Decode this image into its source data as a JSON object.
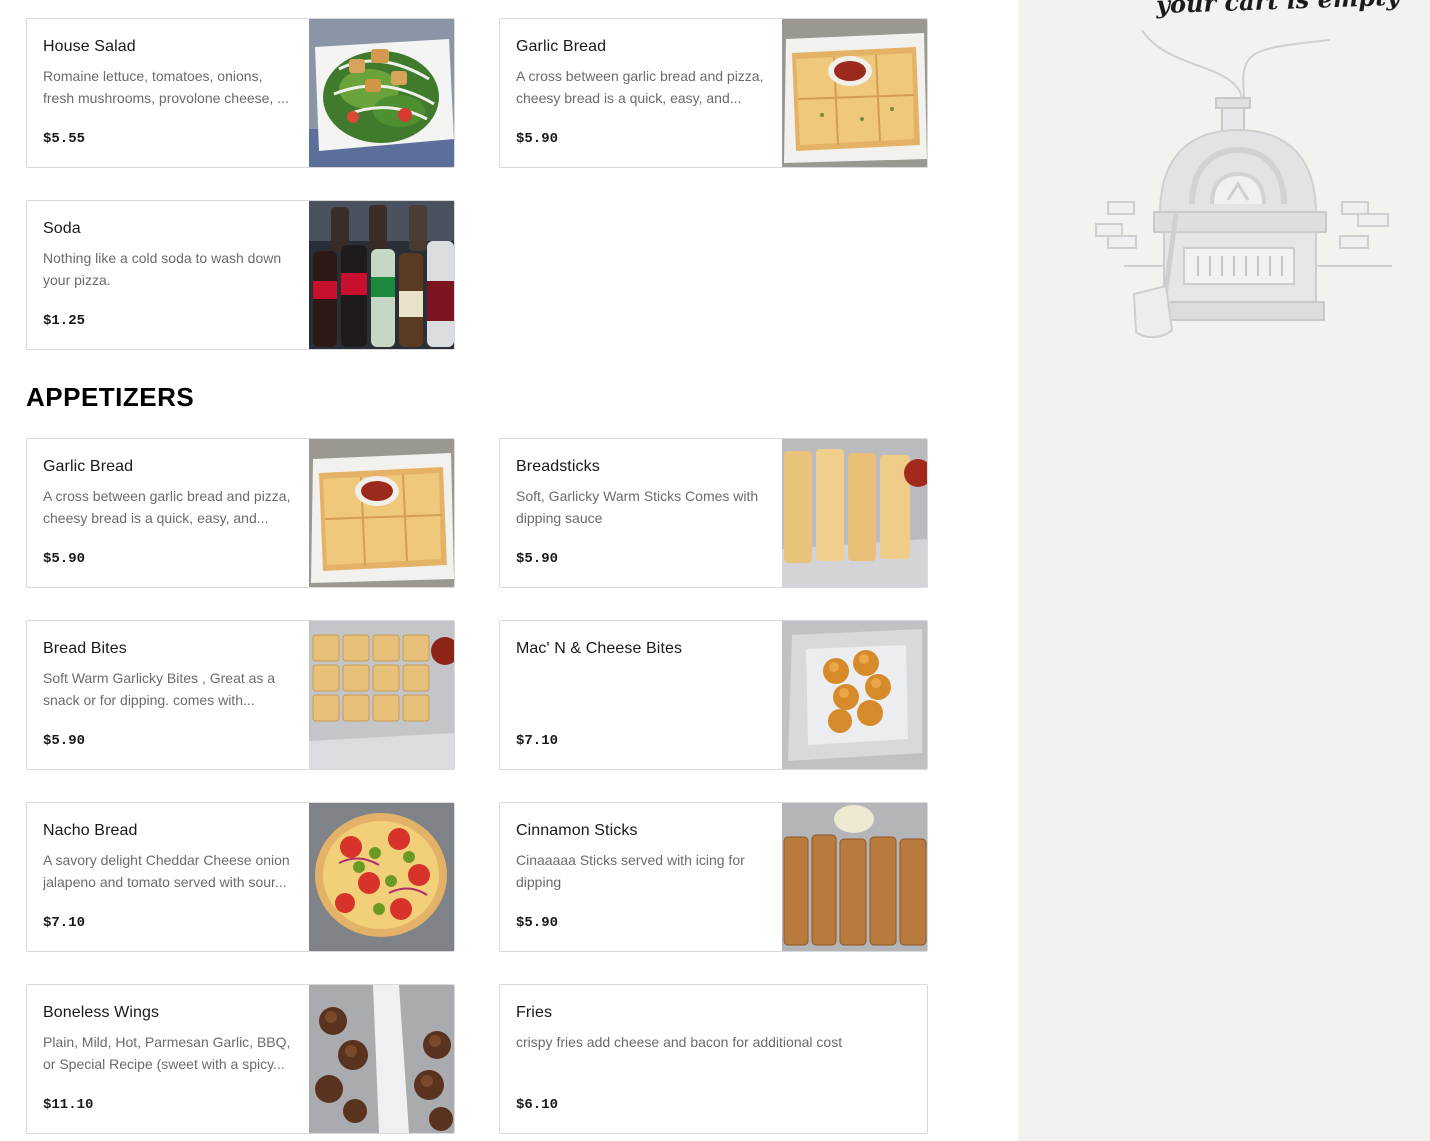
{
  "menu": {
    "top_items": [
      {
        "name": "House Salad",
        "description": "Romaine lettuce, tomatoes, onions, fresh mushrooms, provolone cheese, ...",
        "price": "$5.55",
        "image": "house-salad-photo"
      },
      {
        "name": "Garlic Bread",
        "description": "A cross between garlic bread and pizza, cheesy bread is a quick, easy, and...",
        "price": "$5.90",
        "image": "garlic-bread-photo"
      },
      {
        "name": "Soda",
        "description": "Nothing like a cold soda to wash down your pizza.",
        "price": "$1.25",
        "image": "soda-bottles-photo"
      }
    ],
    "appetizers": {
      "title": "APPETIZERS",
      "items": [
        {
          "name": "Garlic Bread",
          "description": "A cross between garlic bread and pizza, cheesy bread is a quick, easy, and...",
          "price": "$5.90",
          "image": "garlic-bread-photo"
        },
        {
          "name": "Breadsticks",
          "description": "Soft, Garlicky Warm Sticks Comes with dipping sauce",
          "price": "$5.90",
          "image": "breadsticks-photo"
        },
        {
          "name": "Bread Bites",
          "description": "Soft Warm Garlicky Bites , Great as a snack or for dipping. comes with...",
          "price": "$5.90",
          "image": "bread-bites-photo"
        },
        {
          "name": "Mac' N & Cheese Bites",
          "description": "",
          "price": "$7.10",
          "image": "mac-cheese-bites-photo"
        },
        {
          "name": "Nacho Bread",
          "description": "A savory delight Cheddar Cheese onion jalapeno and tomato served with sour...",
          "price": "$7.10",
          "image": "nacho-bread-photo"
        },
        {
          "name": "Cinnamon Sticks",
          "description": "Cinaaaaa Sticks served with icing for dipping",
          "price": "$5.90",
          "image": "cinnamon-sticks-photo"
        },
        {
          "name": "Boneless Wings",
          "description": "Plain, Mild, Hot, Parmesan Garlic, BBQ, or Special Recipe (sweet with a spicy...",
          "price": "$11.10",
          "image": "boneless-wings-photo"
        },
        {
          "name": "Fries",
          "description": "crispy fries add cheese and bacon for additional cost",
          "price": "$6.10",
          "image": ""
        }
      ]
    }
  },
  "cart": {
    "empty_text": "your cart is empty",
    "illustration": "pizza-oven-illustration"
  },
  "colors": {
    "sidebar_bg": "#f3f2ef",
    "card_border": "#d9d9d9",
    "description_text": "#6b6b6b"
  }
}
